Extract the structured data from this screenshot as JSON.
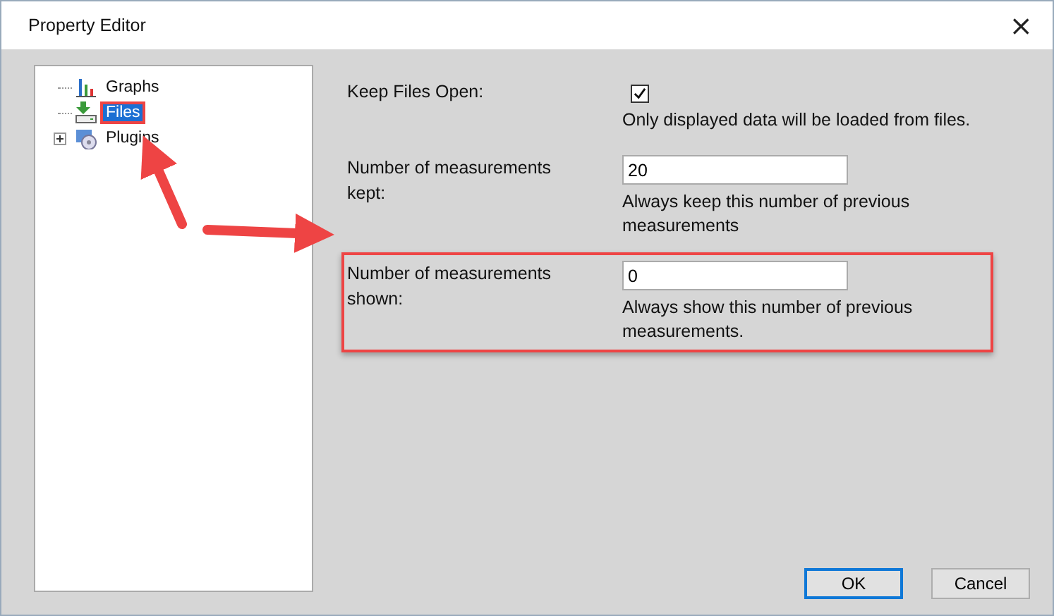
{
  "window": {
    "title": "Property Editor",
    "close": "×"
  },
  "tree": {
    "items": [
      {
        "label": "Graphs",
        "kind": "leaf",
        "selected": false,
        "highlighted": false
      },
      {
        "label": "Files",
        "kind": "leaf",
        "selected": true,
        "highlighted": true
      },
      {
        "label": "Plugins",
        "kind": "collapsed",
        "selected": false,
        "highlighted": false
      }
    ]
  },
  "fields": [
    {
      "label": "Keep Files Open:",
      "kind": "checkbox",
      "checked": true,
      "description": "Only displayed data will be loaded from files.",
      "highlighted": false
    },
    {
      "label": "Number of measurements kept:",
      "kind": "number",
      "value": "20",
      "description": "Always keep this number of previous measurements",
      "highlighted": false
    },
    {
      "label": "Number of measurements shown:",
      "kind": "number",
      "value": "0",
      "description": "Always show this number of previous measurements.",
      "highlighted": true
    }
  ],
  "buttons": [
    {
      "label": "OK",
      "default": true
    },
    {
      "label": "Cancel",
      "default": false
    }
  ]
}
